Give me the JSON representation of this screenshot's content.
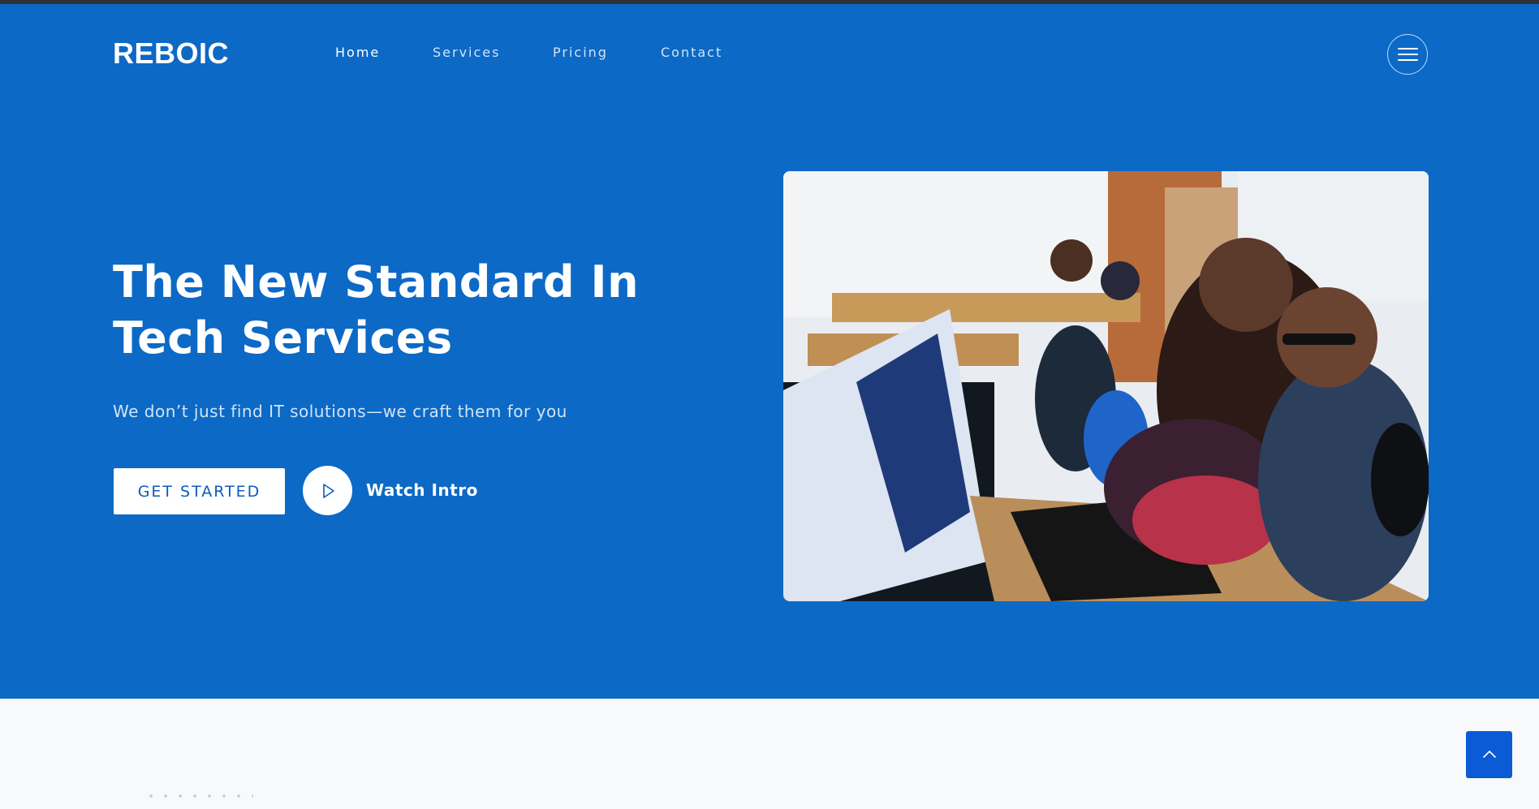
{
  "brand": {
    "logo_text": "REBOIC"
  },
  "nav": {
    "items": [
      {
        "label": "Home",
        "active": true
      },
      {
        "label": "Services",
        "active": false
      },
      {
        "label": "Pricing",
        "active": false
      },
      {
        "label": "Contact",
        "active": false
      }
    ],
    "menu_icon": "hamburger-icon"
  },
  "hero": {
    "title": "The New Standard In Tech Services",
    "subtitle": "We don’t just find IT solutions—we craft them for you",
    "primary_button": "GET STARTED",
    "video_link": "Watch Intro",
    "play_icon": "play-icon",
    "image_alt": "Team working together at computers in an office"
  },
  "scroll_top": {
    "icon": "chevron-up-icon"
  },
  "colors": {
    "hero_background": "#0c69c6",
    "primary_button_text": "#0c5bc0",
    "scroll_top_background": "#0c5bd6",
    "page_background": "#f8f9fa"
  }
}
